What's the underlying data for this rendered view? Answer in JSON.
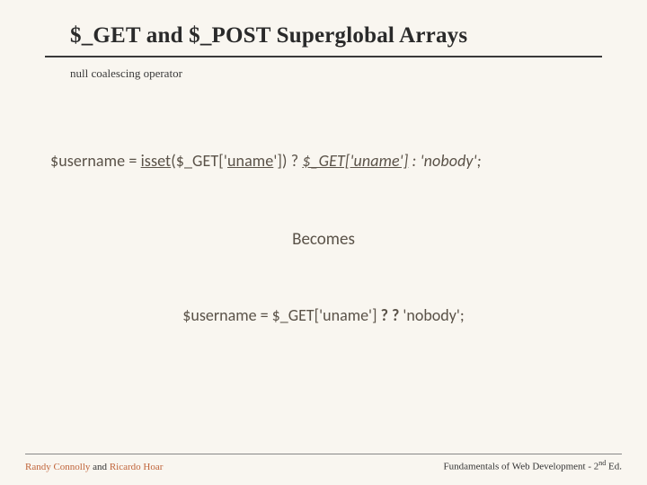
{
  "title": "$_GET and $_POST Superglobal Arrays",
  "subtitle": "null coalescing operator",
  "code1": {
    "a": "$username = ",
    "isset": "isset",
    "b": "($_GET['",
    "uname1": "uname",
    "c": "']) ? ",
    "ital": "$_GET['uname']",
    "d": " : 'nobody';"
  },
  "becomes": "Becomes",
  "code2": {
    "a": "$username = $_GET['",
    "uname": "uname",
    "b": "'] ",
    "op": "? ?",
    "c": " 'nobody';"
  },
  "footer": {
    "left": {
      "author1": "Randy Connolly",
      "and": " and ",
      "author2": "Ricardo Hoar"
    },
    "right": {
      "text1": "Fundamentals of Web Development - 2",
      "sup": "nd",
      "text2": " Ed."
    }
  }
}
